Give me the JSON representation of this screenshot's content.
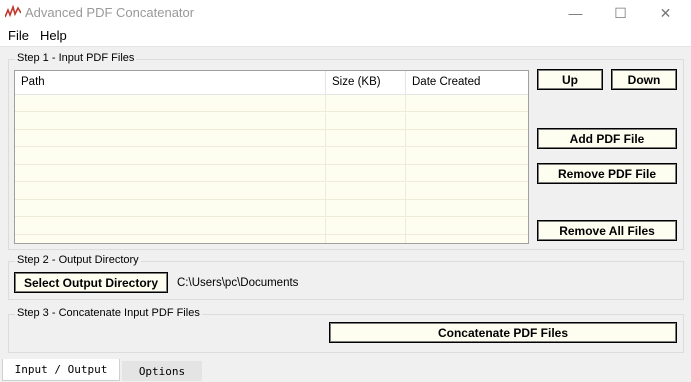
{
  "window": {
    "title": "Advanced PDF Concatenator",
    "minimize_glyph": "—",
    "maximize_glyph": "☐",
    "close_glyph": "✕",
    "accent": "#c0392b"
  },
  "menu": {
    "file": "File",
    "help": "Help"
  },
  "step1": {
    "title": "Step 1 - Input PDF Files",
    "columns": [
      "Path",
      "Size (KB)",
      "Date Created"
    ],
    "rows": [],
    "up": "Up",
    "down": "Down",
    "add": "Add PDF File",
    "remove": "Remove PDF File",
    "remove_all": "Remove All Files"
  },
  "step2": {
    "title": "Step 2 - Output Directory",
    "button": "Select Output Directory",
    "path": "C:\\Users\\pc\\Documents"
  },
  "step3": {
    "title": "Step 3 - Concatenate Input PDF Files",
    "button": "Concatenate PDF Files"
  },
  "tabs": {
    "input_output": "Input / Output",
    "options": "Options"
  }
}
